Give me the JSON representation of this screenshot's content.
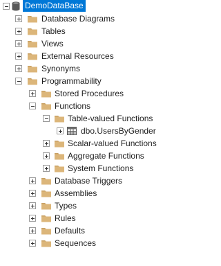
{
  "tree": {
    "root": {
      "label": "DemoDataBase",
      "icon": "database-icon",
      "expanded": true,
      "selected": true
    },
    "nodes": [
      {
        "label": "Database Diagrams",
        "icon": "folder-icon",
        "toggle": "plus"
      },
      {
        "label": "Tables",
        "icon": "folder-icon",
        "toggle": "plus"
      },
      {
        "label": "Views",
        "icon": "folder-icon",
        "toggle": "plus"
      },
      {
        "label": "External Resources",
        "icon": "folder-icon",
        "toggle": "plus"
      },
      {
        "label": "Synonyms",
        "icon": "folder-icon",
        "toggle": "plus"
      },
      {
        "label": "Programmability",
        "icon": "folder-icon",
        "toggle": "minus"
      },
      {
        "label": "Stored Procedures",
        "icon": "folder-icon",
        "toggle": "plus"
      },
      {
        "label": "Functions",
        "icon": "folder-icon",
        "toggle": "minus"
      },
      {
        "label": "Table-valued Functions",
        "icon": "folder-icon",
        "toggle": "minus"
      },
      {
        "label": "dbo.UsersByGender",
        "icon": "table-function-icon",
        "toggle": "plus"
      },
      {
        "label": "Scalar-valued Functions",
        "icon": "folder-icon",
        "toggle": "plus"
      },
      {
        "label": "Aggregate Functions",
        "icon": "folder-icon",
        "toggle": "plus"
      },
      {
        "label": "System Functions",
        "icon": "folder-icon",
        "toggle": "plus"
      },
      {
        "label": "Database Triggers",
        "icon": "folder-icon",
        "toggle": "plus"
      },
      {
        "label": "Assemblies",
        "icon": "folder-icon",
        "toggle": "plus"
      },
      {
        "label": "Types",
        "icon": "folder-icon",
        "toggle": "plus"
      },
      {
        "label": "Rules",
        "icon": "folder-icon",
        "toggle": "plus"
      },
      {
        "label": "Defaults",
        "icon": "folder-icon",
        "toggle": "plus"
      },
      {
        "label": "Sequences",
        "icon": "folder-icon",
        "toggle": "plus"
      }
    ]
  },
  "colors": {
    "selection": "#0078d7",
    "folder": "#dcb67a",
    "folder_dark": "#c8a063",
    "database": "#5a5a5a"
  }
}
